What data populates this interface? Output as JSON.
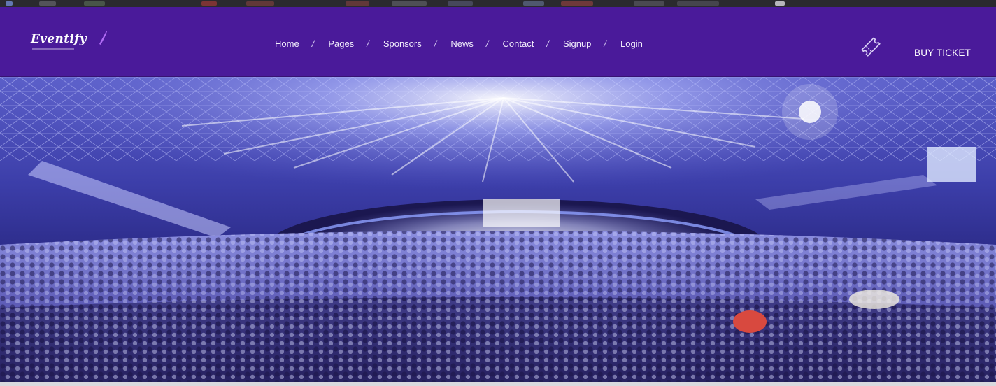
{
  "header": {
    "logo_text": "Eventify",
    "nav": [
      {
        "label": "Home"
      },
      {
        "label": "Pages"
      },
      {
        "label": "Sponsors"
      },
      {
        "label": "News"
      },
      {
        "label": "Contact"
      },
      {
        "label": "Signup"
      },
      {
        "label": "Login"
      }
    ],
    "separator": "/",
    "cta_label": "BUY TICKET",
    "ticket_icon": "ticket-icon"
  },
  "hero": {
    "image": "stadium-concert-crowd"
  },
  "colors": {
    "nav_background": "#4a1a9a",
    "accent": "#b26cf6",
    "hero_tint": "#3b3aa8"
  }
}
